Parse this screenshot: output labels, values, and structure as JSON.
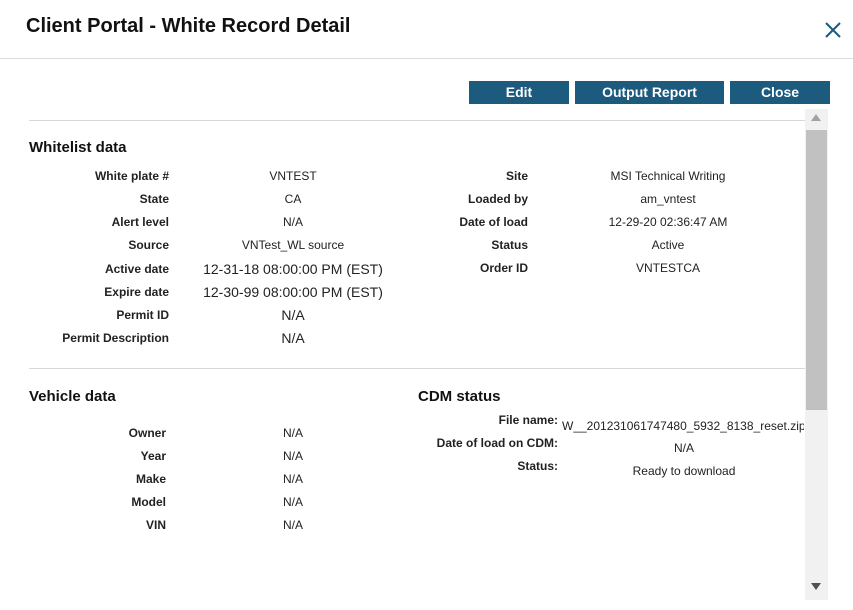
{
  "header": {
    "title": "Client Portal - White Record Detail"
  },
  "toolbar": {
    "edit_label": "Edit",
    "output_report_label": "Output Report",
    "close_label": "Close"
  },
  "whitelist": {
    "title": "Whitelist data",
    "left": [
      {
        "label": "White plate #",
        "value": "VNTEST"
      },
      {
        "label": "State",
        "value": "CA"
      },
      {
        "label": "Alert level",
        "value": "N/A"
      },
      {
        "label": "Source",
        "value": "VNTest_WL source"
      },
      {
        "label": "Active date",
        "value": "12-31-18 08:00:00 PM (EST)"
      },
      {
        "label": "Expire date",
        "value": "12-30-99 08:00:00 PM (EST)"
      },
      {
        "label": "Permit ID",
        "value": "N/A"
      },
      {
        "label": "Permit Description",
        "value": "N/A"
      }
    ],
    "right": [
      {
        "label": "Site",
        "value": "MSI Technical Writing"
      },
      {
        "label": "Loaded by",
        "value": "am_vntest"
      },
      {
        "label": "Date of load",
        "value": "12-29-20 02:36:47 AM"
      },
      {
        "label": "Status",
        "value": "Active"
      },
      {
        "label": "Order ID",
        "value": "VNTESTCA"
      }
    ]
  },
  "vehicle": {
    "title": "Vehicle data",
    "rows": [
      {
        "label": "Owner",
        "value": "N/A"
      },
      {
        "label": "Year",
        "value": "N/A"
      },
      {
        "label": "Make",
        "value": "N/A"
      },
      {
        "label": "Model",
        "value": "N/A"
      },
      {
        "label": "VIN",
        "value": "N/A"
      }
    ]
  },
  "cdm": {
    "title": "CDM status",
    "rows": [
      {
        "label": "File name:",
        "value": "W__201231061747480_5932_8138_reset.zip"
      },
      {
        "label": "Date of load on CDM:",
        "value": "N/A"
      },
      {
        "label": "Status:",
        "value": "Ready to download"
      }
    ]
  },
  "colors": {
    "button": "#1c5a7e",
    "close_icon": "#1c5a7e"
  }
}
